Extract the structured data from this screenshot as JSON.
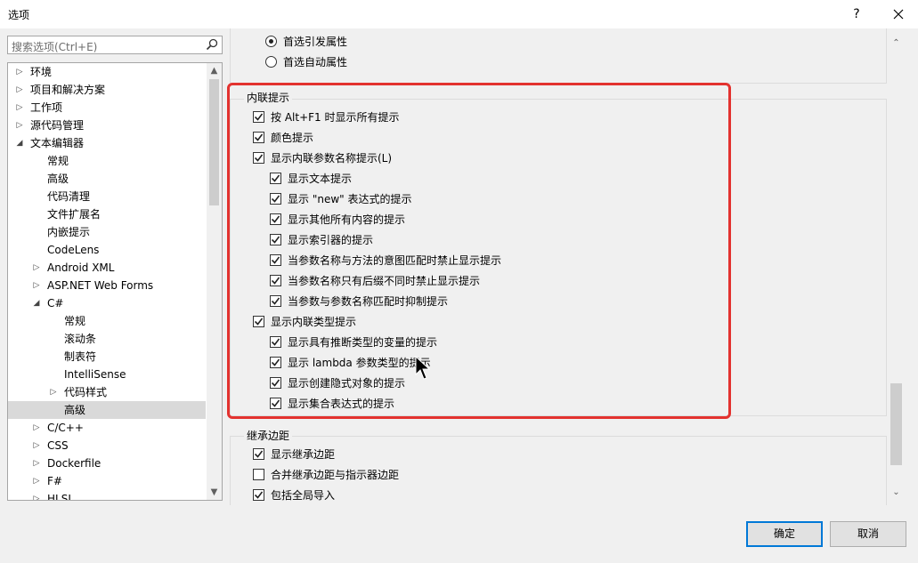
{
  "window": {
    "title": "选项",
    "help_label": "?",
    "close_label": "✕"
  },
  "search": {
    "placeholder": "搜索选项(Ctrl+E)",
    "icon": "search-icon"
  },
  "tree": {
    "items": [
      {
        "label": "环境",
        "level": 0,
        "expander": "collapsed",
        "selected": false
      },
      {
        "label": "项目和解决方案",
        "level": 0,
        "expander": "collapsed",
        "selected": false
      },
      {
        "label": "工作项",
        "level": 0,
        "expander": "collapsed",
        "selected": false
      },
      {
        "label": "源代码管理",
        "level": 0,
        "expander": "collapsed",
        "selected": false
      },
      {
        "label": "文本编辑器",
        "level": 0,
        "expander": "expanded",
        "selected": false
      },
      {
        "label": "常规",
        "level": 1,
        "expander": "none",
        "selected": false
      },
      {
        "label": "高级",
        "level": 1,
        "expander": "none",
        "selected": false
      },
      {
        "label": "代码清理",
        "level": 1,
        "expander": "none",
        "selected": false
      },
      {
        "label": "文件扩展名",
        "level": 1,
        "expander": "none",
        "selected": false
      },
      {
        "label": "内嵌提示",
        "level": 1,
        "expander": "none",
        "selected": false
      },
      {
        "label": "CodeLens",
        "level": 1,
        "expander": "none",
        "selected": false
      },
      {
        "label": "Android XML",
        "level": 1,
        "expander": "collapsed",
        "selected": false
      },
      {
        "label": "ASP.NET Web Forms",
        "level": 1,
        "expander": "collapsed",
        "selected": false
      },
      {
        "label": "C#",
        "level": 1,
        "expander": "expanded",
        "selected": false
      },
      {
        "label": "常规",
        "level": 2,
        "expander": "none",
        "selected": false
      },
      {
        "label": "滚动条",
        "level": 2,
        "expander": "none",
        "selected": false
      },
      {
        "label": "制表符",
        "level": 2,
        "expander": "none",
        "selected": false
      },
      {
        "label": "IntelliSense",
        "level": 2,
        "expander": "none",
        "selected": false
      },
      {
        "label": "代码样式",
        "level": 2,
        "expander": "collapsed",
        "selected": false
      },
      {
        "label": "高级",
        "level": 2,
        "expander": "none",
        "selected": true
      },
      {
        "label": "C/C++",
        "level": 1,
        "expander": "collapsed",
        "selected": false
      },
      {
        "label": "CSS",
        "level": 1,
        "expander": "collapsed",
        "selected": false
      },
      {
        "label": "Dockerfile",
        "level": 1,
        "expander": "collapsed",
        "selected": false
      },
      {
        "label": "F#",
        "level": 1,
        "expander": "collapsed",
        "selected": false
      },
      {
        "label": "HLSL",
        "level": 1,
        "expander": "collapsed",
        "selected": false
      }
    ]
  },
  "top_group": {
    "options": [
      {
        "label": "首选引发属性",
        "type": "radio",
        "checked": true
      },
      {
        "label": "首选自动属性",
        "type": "radio",
        "checked": false
      }
    ]
  },
  "inline_hints": {
    "title": "内联提示",
    "options": [
      {
        "label": "按 Alt+F1 时显示所有提示",
        "checked": true,
        "indent": 0
      },
      {
        "label": "颜色提示",
        "checked": true,
        "indent": 0
      },
      {
        "label": "显示内联参数名称提示(L)",
        "checked": true,
        "indent": 0
      },
      {
        "label": "显示文本提示",
        "checked": true,
        "indent": 1
      },
      {
        "label": "显示 \"new\" 表达式的提示",
        "checked": true,
        "indent": 1
      },
      {
        "label": "显示其他所有内容的提示",
        "checked": true,
        "indent": 1
      },
      {
        "label": "显示索引器的提示",
        "checked": true,
        "indent": 1
      },
      {
        "label": "当参数名称与方法的意图匹配时禁止显示提示",
        "checked": true,
        "indent": 1
      },
      {
        "label": "当参数名称只有后缀不同时禁止显示提示",
        "checked": true,
        "indent": 1
      },
      {
        "label": "当参数与参数名称匹配时抑制提示",
        "checked": true,
        "indent": 1
      },
      {
        "label": "显示内联类型提示",
        "checked": true,
        "indent": 0
      },
      {
        "label": "显示具有推断类型的变量的提示",
        "checked": true,
        "indent": 1
      },
      {
        "label": "显示 lambda 参数类型的提示",
        "checked": true,
        "indent": 1
      },
      {
        "label": "显示创建隐式对象的提示",
        "checked": true,
        "indent": 1
      },
      {
        "label": "显示集合表达式的提示",
        "checked": true,
        "indent": 1
      }
    ]
  },
  "inheritance_margin": {
    "title": "继承边距",
    "options": [
      {
        "label": "显示继承边距",
        "checked": true
      },
      {
        "label": "合并继承边距与指示器边距",
        "checked": false
      },
      {
        "label": "包括全局导入",
        "checked": true
      }
    ]
  },
  "buttons": {
    "ok": "确定",
    "cancel": "取消"
  },
  "colors": {
    "highlight_border": "#e3322f",
    "default_button_border": "#0078d7",
    "selected_tree_bg": "#d9d9d9"
  }
}
